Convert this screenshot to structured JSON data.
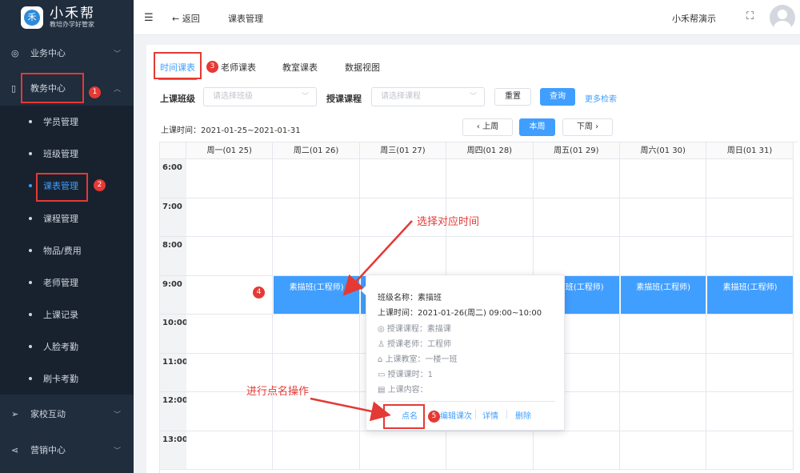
{
  "app": {
    "name": "小禾帮",
    "tagline": "教培办学好管家"
  },
  "topbar": {
    "back_label": "返回",
    "breadcrumb": "课表管理",
    "user_name": "小禾帮演示"
  },
  "sidebar": {
    "groups": [
      {
        "label": "业务中心",
        "icon": "user-circle-icon",
        "expanded": false
      },
      {
        "label": "教务中心",
        "icon": "book-icon",
        "expanded": true
      },
      {
        "label": "家校互动",
        "icon": "send-icon",
        "expanded": false
      },
      {
        "label": "营销中心",
        "icon": "share-icon",
        "expanded": false
      }
    ],
    "sub_items": [
      {
        "label": "学员管理",
        "active": false
      },
      {
        "label": "班级管理",
        "active": false
      },
      {
        "label": "课表管理",
        "active": true
      },
      {
        "label": "课程管理",
        "active": false
      },
      {
        "label": "物品/费用",
        "active": false
      },
      {
        "label": "老师管理",
        "active": false
      },
      {
        "label": "上课记录",
        "active": false
      },
      {
        "label": "人脸考勤",
        "active": false
      },
      {
        "label": "刷卡考勤",
        "active": false
      }
    ]
  },
  "tabs": [
    {
      "label": "时间课表",
      "active": true
    },
    {
      "label": "老师课表",
      "active": false
    },
    {
      "label": "教室课表",
      "active": false
    },
    {
      "label": "数据视图",
      "active": false
    }
  ],
  "filters": {
    "class_label": "上课班级",
    "class_placeholder": "请选择班级",
    "course_label": "授课课程",
    "course_placeholder": "请选择课程",
    "reset_label": "重置",
    "search_label": "查询",
    "more_label": "更多检索"
  },
  "week": {
    "range": "上课时间：2021-01-25~2021-01-31",
    "prev_label": "上周",
    "current_label": "本周",
    "next_label": "下周"
  },
  "schedule": {
    "days": [
      "周一(01 25)",
      "周二(01 26)",
      "周三(01 27)",
      "周四(01 28)",
      "周五(01 29)",
      "周六(01 30)",
      "周日(01 31)"
    ],
    "times": [
      "6:00",
      "7:00",
      "8:00",
      "9:00",
      "10:00",
      "11:00",
      "12:00",
      "13:00"
    ],
    "lessons": [
      {
        "day": 1,
        "hour": 9,
        "label": "素描班(工程师)"
      },
      {
        "day": 2,
        "hour": 9,
        "label": "素描班(工程师)"
      },
      {
        "day": 4,
        "hour": 9,
        "label": "素描班(工程师)"
      },
      {
        "day": 5,
        "hour": 9,
        "label": "素描班(工程师)"
      },
      {
        "day": 6,
        "hour": 9,
        "label": "素描班(工程师)"
      }
    ]
  },
  "popup": {
    "class_name": "班级名称：素描班",
    "time": "上课时间：2021-01-26(周二) 09:00~10:00",
    "course": "授课课程：素描课",
    "teacher": "授课老师：工程师",
    "room": "上课教室：一楼一班",
    "hours": "授课课时：1",
    "content": "上课内容：",
    "actions": [
      "点名",
      "编辑课次",
      "详情",
      "删除"
    ]
  },
  "annotations": {
    "select_time": "选择对应时间",
    "do_rollcall": "进行点名操作",
    "steps": [
      "1",
      "2",
      "3",
      "4",
      "5"
    ]
  },
  "colors": {
    "accent": "#409eff",
    "sidebar": "#1f2d3d",
    "annotation": "#e53935"
  }
}
